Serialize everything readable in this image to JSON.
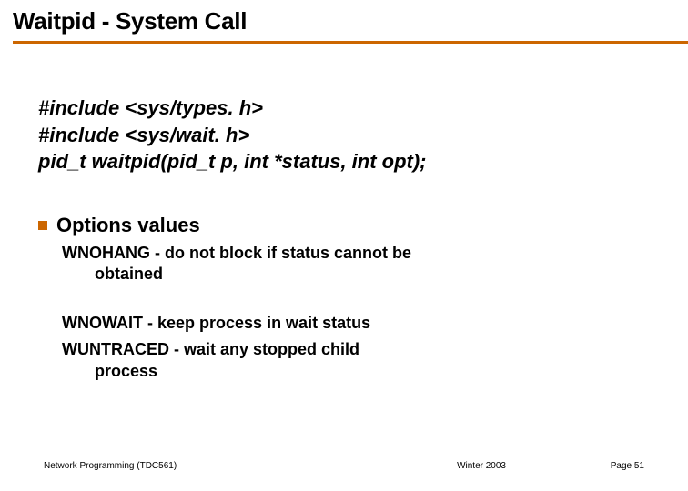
{
  "title": "Waitpid - System Call",
  "code_lines": [
    "#include <sys/types. h>",
    "#include <sys/wait. h>",
    "pid_t waitpid(pid_t p, int *status, int opt);"
  ],
  "bullet_heading": "Options values",
  "options": [
    {
      "name": "WNOHANG",
      "desc_line1": "- do not block if status cannot be",
      "desc_line2": "obtained"
    },
    {
      "name": "WNOWAIT",
      "desc_line1": "- keep process in wait status",
      "desc_line2": ""
    },
    {
      "name": "WUNTRACED",
      "desc_line1": "- wait any stopped child",
      "desc_line2": "process"
    }
  ],
  "footer": {
    "left": "Network Programming (TDC561)",
    "center": "Winter  2003",
    "right": "Page 51"
  }
}
